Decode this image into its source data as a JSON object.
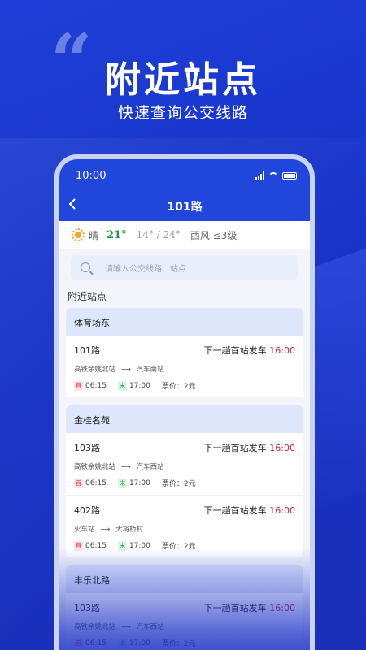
{
  "promo": {
    "quote_mark": "“",
    "headline": "附近站点",
    "subline": "快速查询公交线路"
  },
  "status_bar": {
    "time": "10:00"
  },
  "navbar": {
    "title": "101路",
    "back_icon": "chevron-left-icon"
  },
  "weather": {
    "condition": "晴",
    "temp": "21°",
    "range": "14° / 24°",
    "wind": "西风 ≤3级"
  },
  "search": {
    "placeholder": "请输入公交线路、站点"
  },
  "section_title": "附近站点",
  "groups": [
    {
      "stop": "体育场东",
      "routes": [
        {
          "name": "101路",
          "dep_label": "下一趟首站发车:",
          "dep_time": "16:00",
          "from": "高铁余姚北站",
          "arrow": "⟶",
          "to": "汽车南站",
          "first_tag": "首",
          "first_time": "06:15",
          "last_tag": "末",
          "last_time": "17:00",
          "fare": "票价：2元"
        }
      ]
    },
    {
      "stop": "金桂名苑",
      "routes": [
        {
          "name": "103路",
          "dep_label": "下一趟首站发车:",
          "dep_time": "16:00",
          "from": "高铁余姚北站",
          "arrow": "⟶",
          "to": "汽车西站",
          "first_tag": "首",
          "first_time": "06:15",
          "last_tag": "末",
          "last_time": "17:00",
          "fare": "票价：2元"
        },
        {
          "name": "402路",
          "dep_label": "下一趟首站发车:",
          "dep_time": "16:00",
          "from": "火车站",
          "arrow": "⟶",
          "to": "大将桥村",
          "first_tag": "首",
          "first_time": "06:15",
          "last_tag": "末",
          "last_time": "17:00",
          "fare": "票价：2元"
        }
      ]
    },
    {
      "stop": "丰乐北路",
      "routes": [
        {
          "name": "103路",
          "dep_label": "下一趟首站发车:",
          "dep_time": "16:00",
          "from": "高铁余姚北站",
          "arrow": "⟶",
          "to": "汽车西站",
          "first_tag": "首",
          "first_time": "06:15",
          "last_tag": "末",
          "last_time": "17:00",
          "fare": "票价：2元"
        }
      ]
    }
  ]
}
